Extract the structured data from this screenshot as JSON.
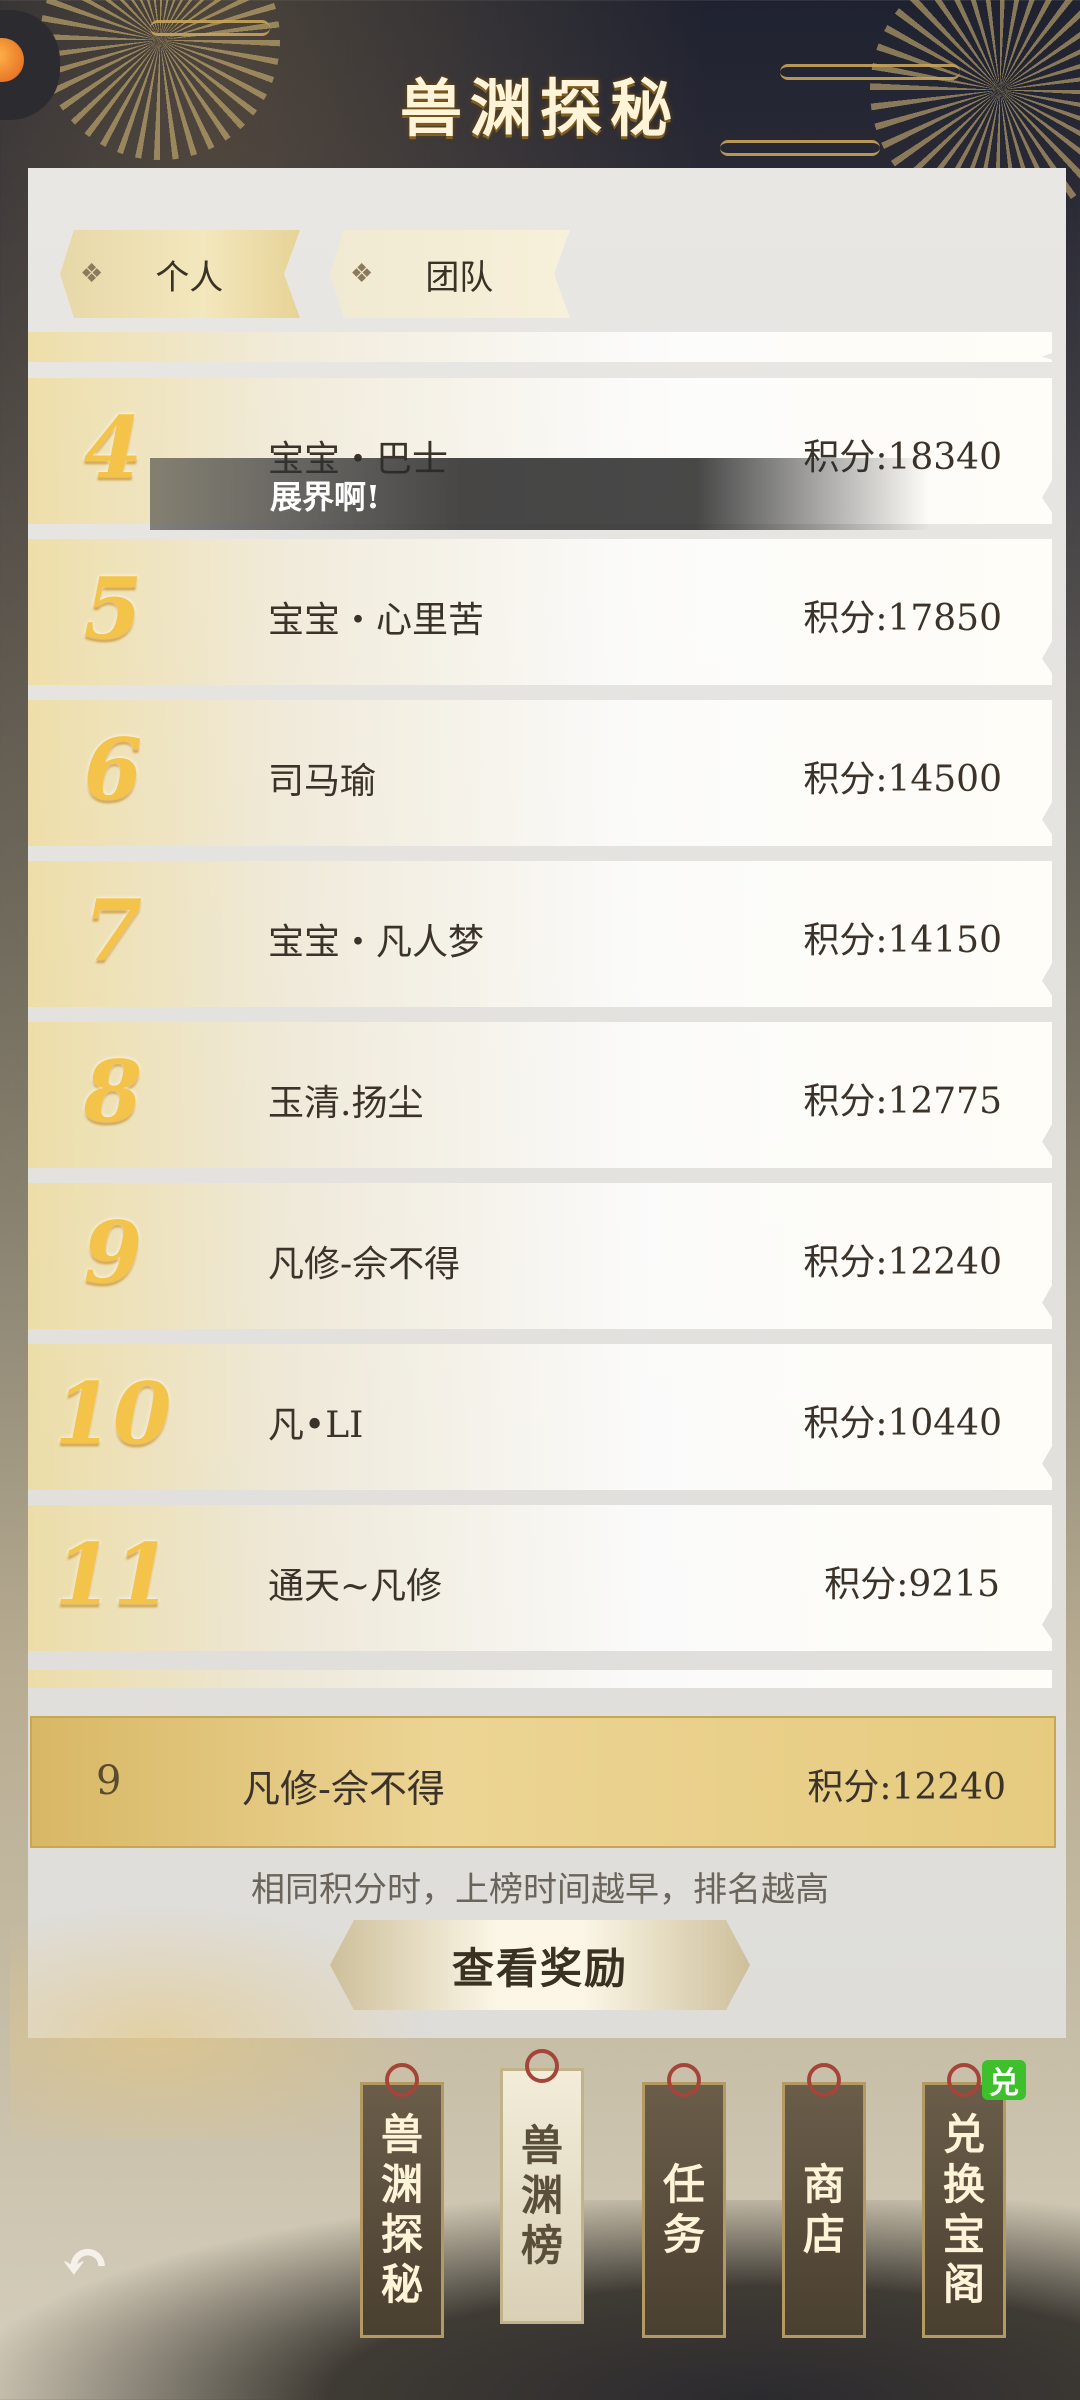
{
  "header": {
    "title": "兽渊探秘"
  },
  "tabs": [
    {
      "label": "个人",
      "selected": true
    },
    {
      "label": "团队",
      "selected": false
    }
  ],
  "toast": {
    "text": "展界啊!"
  },
  "rankings": [
    {
      "rank": "4",
      "name": "宝宝・巴士",
      "score": "积分:18340"
    },
    {
      "rank": "5",
      "name": "宝宝・心里苦",
      "score": "积分:17850"
    },
    {
      "rank": "6",
      "name": "司马瑜",
      "score": "积分:14500"
    },
    {
      "rank": "7",
      "name": "宝宝・凡人梦",
      "score": "积分:14150"
    },
    {
      "rank": "8",
      "name": "玉清.扬尘",
      "score": "积分:12775"
    },
    {
      "rank": "9",
      "name": "凡修-佘不得",
      "score": "积分:12240"
    },
    {
      "rank": "10",
      "name": "凡•LI",
      "score": "积分:10440"
    },
    {
      "rank": "11",
      "name": "通天~凡修",
      "score": "积分:9215"
    }
  ],
  "my_rank": {
    "rank": "9",
    "name": "凡修-佘不得",
    "score": "积分:12240"
  },
  "note": "相同积分时，上榜时间越早，排名越高",
  "reward_button": "查看奖励",
  "bottom_nav": [
    {
      "label": "兽渊探秘",
      "active": false
    },
    {
      "label": "兽渊榜",
      "active": true
    },
    {
      "label": "任务",
      "active": false
    },
    {
      "label": "商店",
      "active": false
    },
    {
      "label": "兑换宝阁",
      "active": false
    }
  ],
  "exchange_badge": "兑",
  "icons": {
    "back": "back-arrow-icon",
    "avatar": "avatar-icon",
    "tab_marker": "diamond-icon"
  }
}
